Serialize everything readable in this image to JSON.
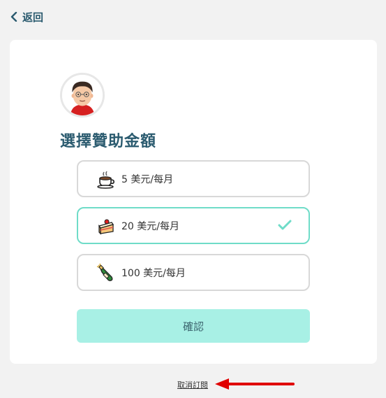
{
  "nav": {
    "back_label": "返回"
  },
  "card": {
    "title": "選擇贊助金額",
    "options": [
      {
        "emoji": "coffee-icon",
        "label": "5 美元/每月",
        "selected": false
      },
      {
        "emoji": "cake-icon",
        "label": "20 美元/每月",
        "selected": true
      },
      {
        "emoji": "champagne-icon",
        "label": "100 美元/每月",
        "selected": false
      }
    ],
    "confirm_label": "確認"
  },
  "footer": {
    "cancel_label": "取消訂閱"
  },
  "colors": {
    "accent": "#6fdcc8",
    "confirm_bg": "#a8f0e5",
    "heading": "#2b5b6f",
    "annotation": "#e00000"
  }
}
